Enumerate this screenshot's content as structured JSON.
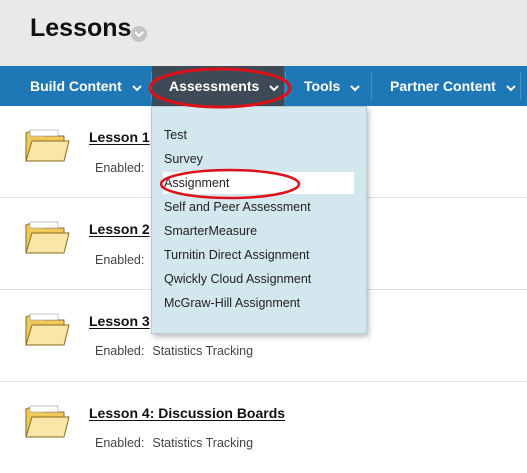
{
  "header": {
    "title": "Lessons"
  },
  "nav": {
    "items": [
      {
        "label": "Build Content"
      },
      {
        "label": "Assessments"
      },
      {
        "label": "Tools"
      },
      {
        "label": "Partner Content"
      }
    ]
  },
  "assessments_menu": {
    "items": [
      {
        "label": "Test"
      },
      {
        "label": "Survey"
      },
      {
        "label": "Assignment"
      },
      {
        "label": "Self and Peer Assessment"
      },
      {
        "label": "SmarterMeasure"
      },
      {
        "label": "Turnitin Direct Assignment"
      },
      {
        "label": "Qwickly Cloud Assignment"
      },
      {
        "label": "McGraw-Hill Assignment"
      }
    ],
    "highlighted": "Assignment"
  },
  "lessons": [
    {
      "title": "Lesson 1",
      "enabled_label": "Enabled:",
      "enabled_value": ""
    },
    {
      "title": "Lesson 2",
      "enabled_label": "Enabled:",
      "enabled_value": ""
    },
    {
      "title": "Lesson 3",
      "enabled_label": "Enabled:",
      "enabled_value": "Statistics Tracking"
    },
    {
      "title": "Lesson 4: Discussion Boards",
      "enabled_label": "Enabled:",
      "enabled_value": "Statistics Tracking"
    }
  ],
  "colors": {
    "navbar": "#1f78b6",
    "nav_active": "#3e4a55",
    "dropdown_bg": "#d3e8ee",
    "annotation": "#e0101a",
    "header_bg": "#e9e9e9"
  },
  "icons": [
    "chevron-down-icon",
    "folder-icon"
  ]
}
